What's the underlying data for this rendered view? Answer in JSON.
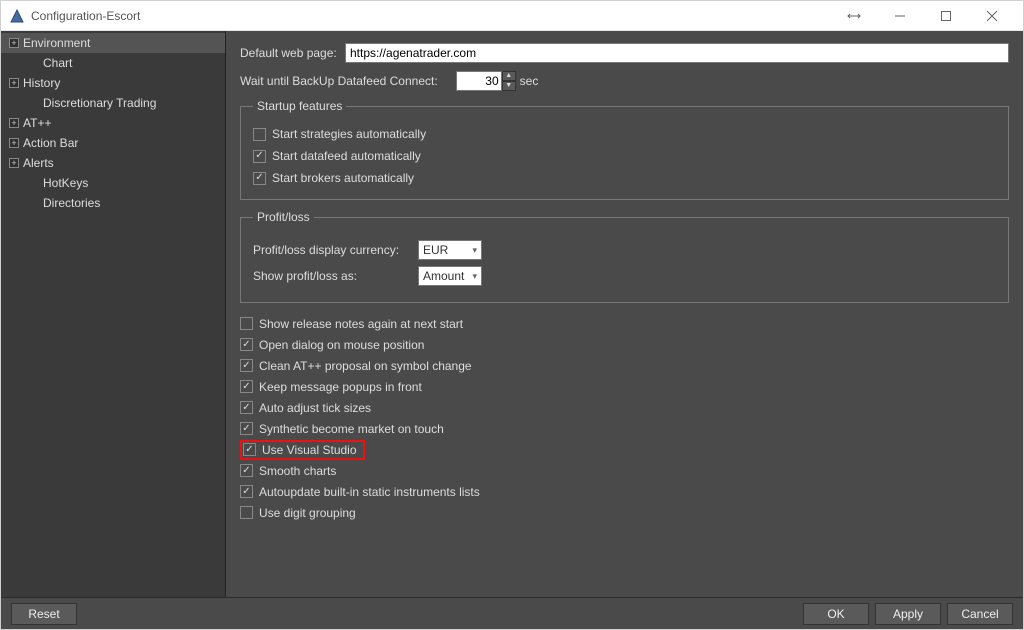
{
  "window": {
    "title": "Configuration-Escort"
  },
  "sidebar": {
    "items": [
      {
        "label": "Environment",
        "expander": "+",
        "selected": true,
        "child": false
      },
      {
        "label": "Chart",
        "expander": "",
        "selected": false,
        "child": true
      },
      {
        "label": "History",
        "expander": "+",
        "selected": false,
        "child": false
      },
      {
        "label": "Discretionary Trading",
        "expander": "",
        "selected": false,
        "child": true
      },
      {
        "label": "AT++",
        "expander": "+",
        "selected": false,
        "child": false
      },
      {
        "label": "Action Bar",
        "expander": "+",
        "selected": false,
        "child": false
      },
      {
        "label": "Alerts",
        "expander": "+",
        "selected": false,
        "child": false
      },
      {
        "label": "HotKeys",
        "expander": "",
        "selected": false,
        "child": true
      },
      {
        "label": "Directories",
        "expander": "",
        "selected": false,
        "child": true
      }
    ]
  },
  "form": {
    "default_web_label": "Default web page:",
    "default_web_value": "https://agenatrader.com",
    "wait_label": "Wait until BackUp Datafeed Connect:",
    "wait_value": "30",
    "wait_unit": "sec",
    "startup_legend": "Startup features",
    "startup": [
      {
        "label": "Start strategies automatically",
        "checked": false
      },
      {
        "label": "Start datafeed automatically",
        "checked": true
      },
      {
        "label": "Start brokers automatically",
        "checked": true
      }
    ],
    "pl_legend": "Profit/loss",
    "pl_currency_label": "Profit/loss display currency:",
    "pl_currency_value": "EUR",
    "pl_showas_label": "Show profit/loss as:",
    "pl_showas_value": "Amount",
    "options": [
      {
        "label": "Show release notes again at next start",
        "checked": false,
        "highlight": false
      },
      {
        "label": "Open dialog on mouse position",
        "checked": true,
        "highlight": false
      },
      {
        "label": "Clean AT++ proposal on symbol change",
        "checked": true,
        "highlight": false
      },
      {
        "label": "Keep message popups in front",
        "checked": true,
        "highlight": false
      },
      {
        "label": "Auto adjust tick sizes",
        "checked": true,
        "highlight": false
      },
      {
        "label": "Synthetic become market on touch",
        "checked": true,
        "highlight": false
      },
      {
        "label": "Use Visual Studio",
        "checked": true,
        "highlight": true
      },
      {
        "label": "Smooth charts",
        "checked": true,
        "highlight": false
      },
      {
        "label": "Autoupdate built-in static instruments lists",
        "checked": true,
        "highlight": false
      },
      {
        "label": "Use digit grouping",
        "checked": false,
        "highlight": false
      }
    ]
  },
  "footer": {
    "reset": "Reset",
    "ok": "OK",
    "apply": "Apply",
    "cancel": "Cancel"
  }
}
